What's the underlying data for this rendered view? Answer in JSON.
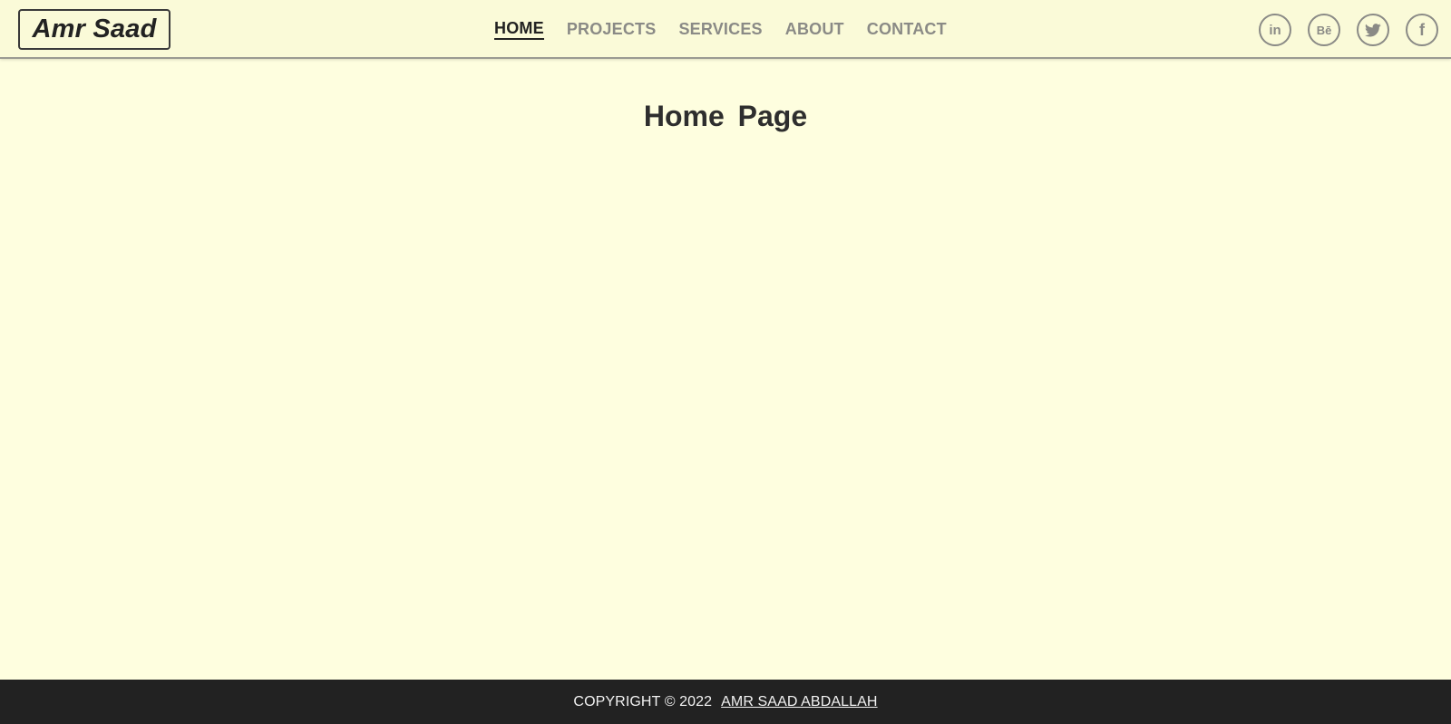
{
  "brand": {
    "name": "Amr Saad"
  },
  "nav": {
    "items": [
      {
        "label": "HOME",
        "active": true
      },
      {
        "label": "PROJECTS",
        "active": false
      },
      {
        "label": "SERVICES",
        "active": false
      },
      {
        "label": "ABOUT",
        "active": false
      },
      {
        "label": "CONTACT",
        "active": false
      }
    ]
  },
  "social": [
    {
      "icon": "linkedin-icon",
      "glyph": "in"
    },
    {
      "icon": "behance-icon",
      "glyph": "Bē"
    },
    {
      "icon": "twitter-icon",
      "glyph": ""
    },
    {
      "icon": "facebook-icon",
      "glyph": "f"
    }
  ],
  "main": {
    "title": "Home Page"
  },
  "footer": {
    "copyright": "COPYRIGHT © 2022",
    "author": "AMR SAAD ABDALLAH"
  },
  "colors": {
    "background": "#fefedf",
    "navbar": "#fafad8",
    "nav_inactive": "#8a8a86",
    "nav_active": "#222222",
    "footer": "#222222"
  }
}
